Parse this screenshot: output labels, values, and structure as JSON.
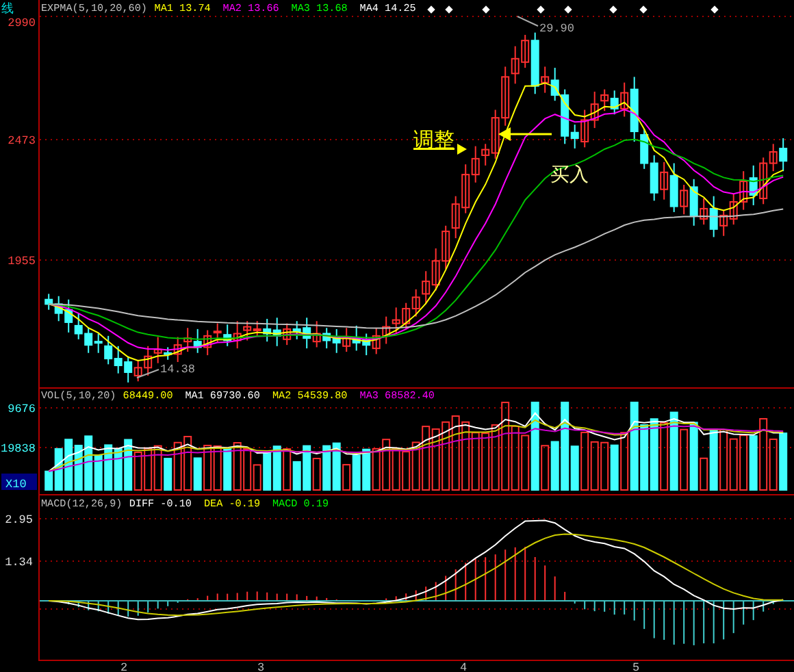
{
  "chart_title": "线",
  "price_panel": {
    "legend": {
      "label": "EXPMA(5,10,20,60)",
      "items": [
        {
          "name": "MA1",
          "value": "13.74",
          "color": "#ffff00"
        },
        {
          "name": "MA2",
          "value": "13.66",
          "color": "#ff00ff"
        },
        {
          "name": "MA3",
          "value": "13.68",
          "color": "#00ff00"
        },
        {
          "name": "MA4",
          "value": "14.25",
          "color": "#ffffff"
        }
      ]
    },
    "axis_labels": [
      "2990",
      "2473",
      "1955"
    ],
    "high_label": "29.90",
    "low_label": "14.38",
    "annotations": [
      {
        "kind": "adjust",
        "text": "调整"
      },
      {
        "kind": "buy",
        "text": "买入"
      }
    ]
  },
  "volume_panel": {
    "legend": {
      "label": "VOL(5,10,20)",
      "items": [
        {
          "value": "68449.00",
          "color": "#ffff00"
        },
        {
          "name": "MA1",
          "value": "69730.60",
          "color": "#ffffff"
        },
        {
          "name": "MA2",
          "value": "54539.80",
          "color": "#ffff00"
        },
        {
          "name": "MA3",
          "value": "68582.40",
          "color": "#ff00ff"
        }
      ]
    },
    "axis_labels": [
      "9676",
      "19838"
    ],
    "unit": "X10"
  },
  "macd_panel": {
    "legend": {
      "label": "MACD(12,26,9)",
      "items": [
        {
          "name": "DIFF",
          "value": "-0.10",
          "color": "#ffffff"
        },
        {
          "name": "DEA",
          "value": "-0.19",
          "color": "#ffff00"
        },
        {
          "name": "MACD",
          "value": "0.19",
          "color": "#00ff00"
        }
      ]
    },
    "axis_labels": [
      "2.95",
      "1.34"
    ]
  },
  "x_axis_labels": [
    "2",
    "3",
    "4",
    "5"
  ]
}
